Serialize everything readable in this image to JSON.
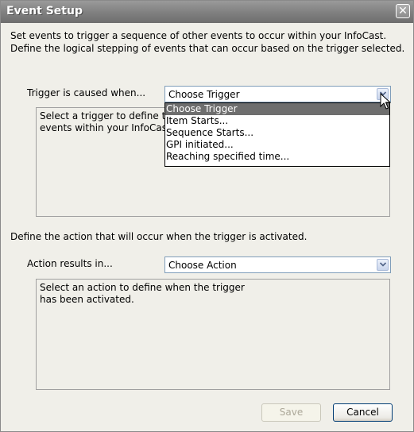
{
  "window": {
    "title": "Event Setup",
    "close_glyph": "✕"
  },
  "intro": {
    "line1": "Set events to trigger a sequence of other events to occur within your InfoCast.",
    "line2": "Define the logical stepping of events that can occur based on the trigger selected."
  },
  "trigger": {
    "label": "Trigger is caused when...",
    "selected": "Choose Trigger",
    "description_line1": "Select a trigger to define the",
    "description_line2": "events within your InfoCast",
    "options": [
      "Choose Trigger",
      "Item Starts...",
      "Sequence Starts...",
      "GPI initiated...",
      "Reaching specified time..."
    ],
    "highlighted_index": 0,
    "dropdown_open": true
  },
  "action_section": {
    "prompt": "Define the action that will occur when the trigger is activated."
  },
  "action": {
    "label": "Action results in...",
    "selected": "Choose Action",
    "description_line1": "Select an action to define when the trigger",
    "description_line2": "has been activated."
  },
  "buttons": {
    "save": "Save",
    "cancel": "Cancel",
    "save_enabled": false
  },
  "colors": {
    "title_bar": "#8a8a8a",
    "dialog_bg": "#f0efe9",
    "highlight": "#6e6e6e",
    "combo_border": "#7f9db9"
  },
  "icons": {
    "close": "close-icon",
    "dropdown_arrow": "chevron-down-icon",
    "pointer": "mouse-pointer-icon"
  }
}
